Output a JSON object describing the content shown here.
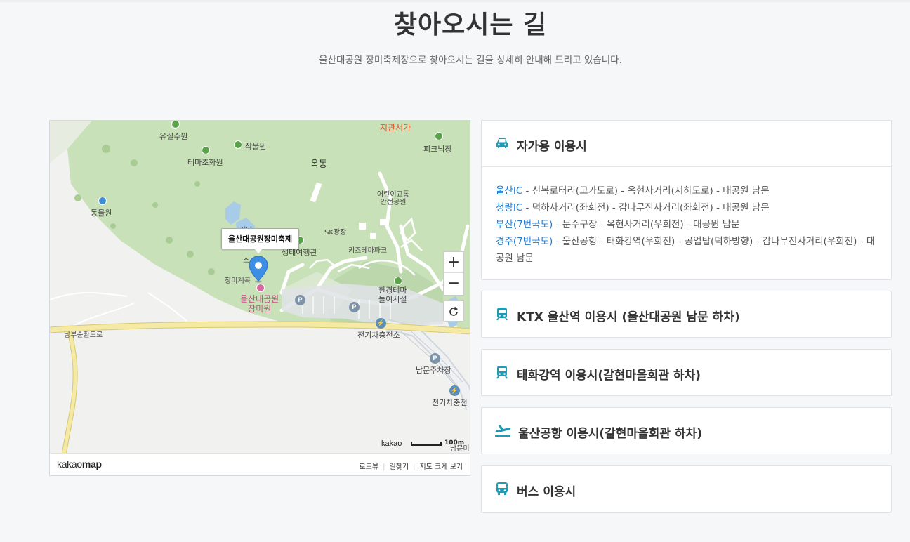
{
  "header": {
    "title": "찾아오시는 길",
    "subtitle": "울산대공원 장미축제장으로 찾아오시는 길을 상세히 안내해 드리고 있습니다."
  },
  "map": {
    "popup": "울산대공원장미축제",
    "labels": {
      "jigwan": "지관서가",
      "yusil": "유실수원",
      "jangmul": "작물원",
      "temacho": "테마초화원",
      "okdong": "옥동",
      "picnic": "피크닉장",
      "zoo": "동물원",
      "child_safety": "어린이교통\n안전공원",
      "sk": "SK광장",
      "kids": "키즈테마파크",
      "eco": "생태여행관",
      "rose_valley": "장미계곡",
      "park_rose": "울산대공원\n장미원",
      "env_theme": "환경테마\n놀이시설",
      "ev1": "전기차충전소",
      "south_parking": "남문주차장",
      "ev2": "전기차충전",
      "road": "남부순환도로",
      "gangdang": "강당",
      "so": "소",
      "south_gate": "남문미"
    },
    "zoom_in": "+",
    "zoom_out": "−",
    "scale_brand": "kakao",
    "scale_value": "100m",
    "footer": {
      "logo_light": "kakao",
      "logo_bold": "map",
      "links": [
        "로드뷰",
        "길찾기",
        "지도 크게 보기"
      ]
    }
  },
  "sections": [
    {
      "title": "자가용 이용시",
      "icon": "car-icon",
      "expanded": true,
      "routes": [
        {
          "key": "울산IC",
          "path": " - 신복로터리(고가도로) - 옥현사거리(지하도로) - 대공원 남문"
        },
        {
          "key": "청량IC",
          "path": " - 덕하사거리(좌회전) - 감나무진사거리(좌회전) - 대공원 남문"
        },
        {
          "key": "부산(7번국도)",
          "path": " - 문수구장 - 옥현사거리(우회전) - 대공원 남문"
        },
        {
          "key": "경주(7번국도)",
          "path": " - 울산공항 - 태화강역(우회전) - 공업탑(덕하방향) - 감나무진사거리(우회전) - 대공원 남문"
        }
      ]
    },
    {
      "title": "KTX 울산역 이용시 (울산대공원 남문 하차)",
      "icon": "train-icon",
      "expanded": false
    },
    {
      "title": "태화강역 이용시(갈현마을회관 하차)",
      "icon": "train-icon",
      "expanded": false
    },
    {
      "title": "울산공항 이용시(갈현마을회관 하차)",
      "icon": "airplane-icon",
      "expanded": false
    },
    {
      "title": "버스 이용시",
      "icon": "bus-icon",
      "expanded": false
    }
  ],
  "colors": {
    "accent": "#1f9bb5",
    "link": "#1f7ad1",
    "map_park": "#c9e1b9",
    "map_road": "#f2e8a3"
  }
}
